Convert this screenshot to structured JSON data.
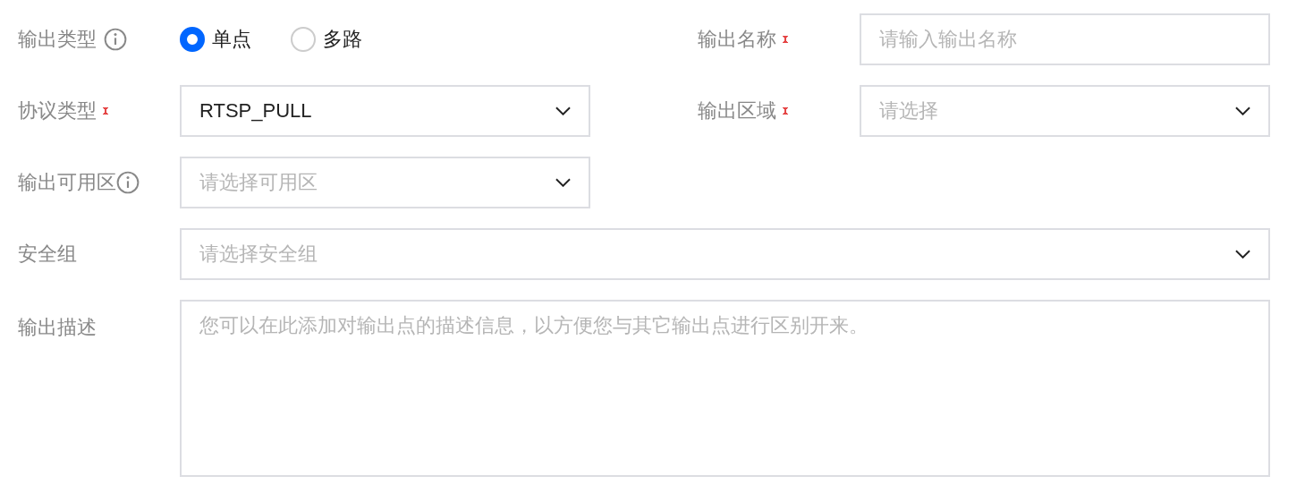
{
  "output_type": {
    "label": "输出类型",
    "info": true,
    "options": [
      {
        "label": "单点",
        "selected": true
      },
      {
        "label": "多路",
        "selected": false
      }
    ]
  },
  "output_name": {
    "label": "输出名称",
    "required": true,
    "placeholder": "请输入输出名称"
  },
  "protocol": {
    "label": "协议类型",
    "required": true,
    "value": "RTSP_PULL"
  },
  "output_region": {
    "label": "输出区域",
    "required": true,
    "placeholder": "请选择"
  },
  "availability_zone": {
    "label": "输出可用区",
    "info": true,
    "placeholder": "请选择可用区"
  },
  "security_group": {
    "label": "安全组",
    "placeholder": "请选择安全组"
  },
  "description": {
    "label": "输出描述",
    "placeholder": "您可以在此添加对输出点的描述信息，以方便您与其它输出点进行区别开来。"
  }
}
